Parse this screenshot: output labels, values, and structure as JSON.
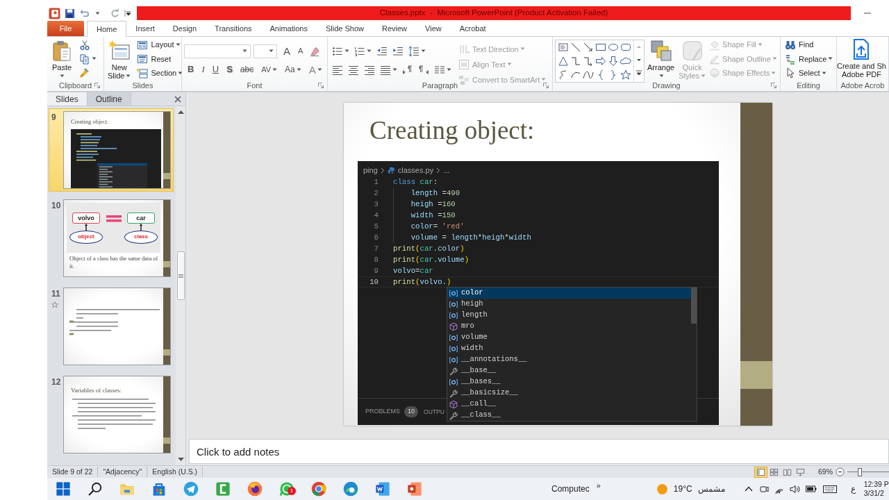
{
  "title_bar": {
    "title": "Classes.pptx  -  Microsoft PowerPoint (Product Activation Failed)"
  },
  "ribbon_tabs": [
    {
      "label": "File",
      "kind": "file",
      "selected": false
    },
    {
      "label": "Home",
      "kind": "tab",
      "selected": true
    },
    {
      "label": "Insert",
      "kind": "tab",
      "selected": false
    },
    {
      "label": "Design",
      "kind": "tab",
      "selected": false
    },
    {
      "label": "Transitions",
      "kind": "tab",
      "selected": false
    },
    {
      "label": "Animations",
      "kind": "tab",
      "selected": false
    },
    {
      "label": "Slide Show",
      "kind": "tab",
      "selected": false
    },
    {
      "label": "Review",
      "kind": "tab",
      "selected": false
    },
    {
      "label": "View",
      "kind": "tab",
      "selected": false
    },
    {
      "label": "Acrobat",
      "kind": "tab",
      "selected": false
    }
  ],
  "ribbon_groups": [
    {
      "label": "Clipboard",
      "launcher": true,
      "columns": [
        [
          {
            "kind": "large",
            "label": "Paste\n",
            "dropdown": true,
            "disabled": false
          }
        ],
        [
          {
            "kind": "icon",
            "dropdown": false,
            "disabled": false
          },
          {
            "kind": "icon",
            "dropdown": true,
            "disabled": false
          },
          {
            "kind": "icon",
            "dropdown": false,
            "disabled": false
          }
        ]
      ]
    },
    {
      "label": "Slides",
      "columns": [
        [
          {
            "kind": "large",
            "label": "New\nSlide",
            "dropdown": true,
            "disabled": false
          }
        ],
        [
          {
            "kind": "small",
            "label": "Layout",
            "dropdown": true,
            "disabled": false
          },
          {
            "kind": "small",
            "label": "Reset",
            "dropdown": false,
            "disabled": false
          },
          {
            "kind": "small",
            "label": "Section",
            "dropdown": true,
            "disabled": false
          }
        ]
      ]
    },
    {
      "label": "Font",
      "launcher": true,
      "columns": [
        [
          [
            {
              "kind": "combo"
            },
            {
              "kind": "combo"
            },
            {
              "kind": "glyph",
              "label": "A",
              "dropdown": false
            },
            {
              "kind": "glyph",
              "label": "A",
              "dropdown": false
            },
            {
              "kind": "icon",
              "dropdown": false,
              "disabled": false
            }
          ],
          [
            {
              "kind": "glyph",
              "label": "B",
              "dropdown": false
            },
            {
              "kind": "glyph",
              "label": "I",
              "dropdown": false
            },
            {
              "kind": "glyph",
              "label": "U",
              "dropdown": false
            },
            {
              "kind": "glyph",
              "label": "S",
              "dropdown": false
            },
            {
              "kind": "glyph",
              "label": "abc",
              "dropdown": false
            },
            {
              "kind": "glyph",
              "label": "AV",
              "dropdown": true
            },
            {
              "kind": "glyph",
              "label": "Aa",
              "dropdown": true
            },
            {
              "kind": "glyph",
              "label": "A",
              "dropdown": true
            }
          ]
        ]
      ]
    },
    {
      "label": "Paragraph",
      "launcher": true,
      "columns": [
        [
          [
            {
              "kind": "icon",
              "dropdown": true,
              "disabled": false
            },
            {
              "kind": "icon",
              "dropdown": true,
              "disabled": false
            },
            {
              "kind": "icon",
              "dropdown": false,
              "disabled": false
            },
            {
              "kind": "icon",
              "dropdown": false,
              "disabled": false
            },
            {
              "kind": "icon",
              "dropdown": true,
              "disabled": false
            }
          ],
          [
            {
              "kind": "icon",
              "dropdown": false,
              "disabled": false
            },
            {
              "kind": "icon",
              "dropdown": false,
              "disabled": false
            },
            {
              "kind": "icon",
              "dropdown": false,
              "disabled": false
            },
            {
              "kind": "icon",
              "dropdown": true,
              "disabled": false
            },
            {
              "kind": "icon",
              "dropdown": false,
              "disabled": false
            },
            {
              "kind": "icon",
              "dropdown": false,
              "disabled": false
            },
            {
              "kind": "icon",
              "dropdown": true,
              "disabled": false
            }
          ]
        ],
        [
          {
            "kind": "small",
            "label": "Text Direction",
            "dropdown": true,
            "disabled": true
          },
          {
            "kind": "small",
            "label": "Align Text",
            "dropdown": true,
            "disabled": true
          },
          {
            "kind": "small",
            "label": "Convert to SmartArt",
            "dropdown": true,
            "disabled": true
          }
        ]
      ]
    },
    {
      "label": "Drawing",
      "launcher": true,
      "columns": [
        [
          {
            "kind": "gallery"
          }
        ],
        [
          {
            "kind": "large",
            "label": "Arrange\n",
            "dropdown": true,
            "disabled": false
          }
        ],
        [
          {
            "kind": "large",
            "label": "Quick\nStyles",
            "dropdown": true,
            "disabled": true
          }
        ],
        [
          {
            "kind": "small",
            "label": "Shape Fill",
            "dropdown": true,
            "disabled": true
          },
          {
            "kind": "small",
            "label": "Shape Outline",
            "dropdown": true,
            "disabled": true
          },
          {
            "kind": "small",
            "label": "Shape Effects",
            "dropdown": true,
            "disabled": true
          }
        ]
      ]
    },
    {
      "label": "Editing",
      "columns": [
        [
          {
            "kind": "small",
            "label": "Find",
            "dropdown": false,
            "disabled": false
          },
          {
            "kind": "small",
            "label": "Replace",
            "dropdown": true,
            "disabled": false
          },
          {
            "kind": "small",
            "label": "Select",
            "dropdown": true,
            "disabled": false
          }
        ]
      ]
    },
    {
      "label": "Adobe Acrob",
      "columns": [
        [
          {
            "kind": "large",
            "label": "Create and Sh\nAdobe PDF",
            "dropdown": false,
            "disabled": false
          }
        ]
      ]
    }
  ],
  "slides_pane": {
    "tabs": [
      {
        "label": "Slides",
        "selected": true
      },
      {
        "label": "Outline",
        "selected": false
      }
    ],
    "thumbnails": [
      {
        "number": "9",
        "selected": true,
        "animated": false,
        "kind": "code",
        "title": "Creating object:"
      },
      {
        "number": "10",
        "selected": false,
        "animated": false,
        "kind": "diagram",
        "boxes": [
          "volvo",
          "car"
        ],
        "ovals": [
          "object",
          "class"
        ],
        "caption": "Object of a class has the same data of it."
      },
      {
        "number": "11",
        "selected": false,
        "animated": true,
        "kind": "bullets"
      },
      {
        "number": "12",
        "selected": false,
        "animated": false,
        "kind": "bullets",
        "title": "Variables of classes:"
      }
    ]
  },
  "slide": {
    "title": "Creating object:",
    "editor": {
      "breadcrumb": [
        "ping",
        "classes.py",
        "..."
      ],
      "lines": [
        {
          "number": "1",
          "active": false,
          "indent": false,
          "tokens": [
            {
              "text": "class ",
              "kind": "kw"
            },
            {
              "text": "car",
              "kind": "cls"
            },
            {
              "text": ":",
              "kind": "plain"
            }
          ]
        },
        {
          "number": "2",
          "active": false,
          "indent": true,
          "tokens": [
            {
              "text": "length",
              "kind": "var"
            },
            {
              "text": " =",
              "kind": "plain"
            },
            {
              "text": "490",
              "kind": "num"
            }
          ]
        },
        {
          "number": "3",
          "active": false,
          "indent": true,
          "tokens": [
            {
              "text": "heigh",
              "kind": "var"
            },
            {
              "text": " =",
              "kind": "plain"
            },
            {
              "text": "160",
              "kind": "num"
            }
          ]
        },
        {
          "number": "4",
          "active": false,
          "indent": true,
          "tokens": [
            {
              "text": "width",
              "kind": "var"
            },
            {
              "text": " =",
              "kind": "plain"
            },
            {
              "text": "150",
              "kind": "num"
            }
          ]
        },
        {
          "number": "5",
          "active": false,
          "indent": true,
          "tokens": [
            {
              "text": "color",
              "kind": "var"
            },
            {
              "text": "= ",
              "kind": "plain"
            },
            {
              "text": "'red'",
              "kind": "str"
            }
          ]
        },
        {
          "number": "6",
          "active": false,
          "indent": true,
          "tokens": [
            {
              "text": "volume",
              "kind": "var"
            },
            {
              "text": " = ",
              "kind": "plain"
            },
            {
              "text": "length",
              "kind": "var"
            },
            {
              "text": "*",
              "kind": "plain"
            },
            {
              "text": "heigh",
              "kind": "var"
            },
            {
              "text": "*",
              "kind": "plain"
            },
            {
              "text": "width",
              "kind": "var"
            }
          ]
        },
        {
          "number": "7",
          "active": false,
          "indent": false,
          "tokens": [
            {
              "text": "print",
              "kind": "fn"
            },
            {
              "text": "(",
              "kind": "br"
            },
            {
              "text": "car",
              "kind": "cls"
            },
            {
              "text": ".",
              "kind": "plain"
            },
            {
              "text": "color",
              "kind": "var"
            },
            {
              "text": ")",
              "kind": "br"
            }
          ]
        },
        {
          "number": "8",
          "active": false,
          "indent": false,
          "tokens": [
            {
              "text": "print",
              "kind": "fn"
            },
            {
              "text": "(",
              "kind": "br"
            },
            {
              "text": "car",
              "kind": "cls"
            },
            {
              "text": ".",
              "kind": "plain"
            },
            {
              "text": "volume",
              "kind": "var"
            },
            {
              "text": ")",
              "kind": "br"
            }
          ]
        },
        {
          "number": "9",
          "active": false,
          "indent": false,
          "tokens": [
            {
              "text": "volvo",
              "kind": "var"
            },
            {
              "text": "=",
              "kind": "plain"
            },
            {
              "text": "car",
              "kind": "cls"
            }
          ]
        },
        {
          "number": "10",
          "active": true,
          "indent": false,
          "tokens": [
            {
              "text": "print",
              "kind": "fn"
            },
            {
              "text": "(",
              "kind": "br"
            },
            {
              "text": "volvo",
              "kind": "var"
            },
            {
              "text": ".",
              "kind": "plain"
            },
            {
              "text": ")",
              "kind": "br"
            }
          ]
        }
      ],
      "suggestions": [
        {
          "label": "color",
          "kind": "field",
          "selected": true
        },
        {
          "label": "heigh",
          "kind": "field",
          "selected": false
        },
        {
          "label": "length",
          "kind": "field",
          "selected": false
        },
        {
          "label": "mro",
          "kind": "method",
          "selected": false
        },
        {
          "label": "volume",
          "kind": "field",
          "selected": false
        },
        {
          "label": "width",
          "kind": "field",
          "selected": false
        },
        {
          "label": "__annotations__",
          "kind": "field",
          "selected": false
        },
        {
          "label": "__base__",
          "kind": "property",
          "selected": false
        },
        {
          "label": "__bases__",
          "kind": "field",
          "selected": false
        },
        {
          "label": "__basicsize__",
          "kind": "property",
          "selected": false
        },
        {
          "label": "__call__",
          "kind": "method",
          "selected": false
        },
        {
          "label": "__class__",
          "kind": "property",
          "selected": false
        }
      ],
      "panel": {
        "problems": "PROBLEMS",
        "count": "10",
        "output": "OUTPU"
      }
    }
  },
  "notes": {
    "placeholder": "Click to add notes"
  },
  "status_bar": {
    "items": [
      "Slide 9 of 22",
      "\"Adjacency\"",
      "English (U.S.)"
    ],
    "views": [
      {
        "selected": true
      },
      {
        "selected": false
      },
      {
        "selected": false
      },
      {
        "selected": false
      }
    ],
    "zoom": "69%",
    "zoom_slider": {
      "level": 0.3
    }
  },
  "taskbar": {
    "badge": "1",
    "label": "Computec",
    "overflow": "»",
    "temperature": "19°C",
    "weather": "مشمس",
    "input_language": "ع",
    "time": "12:39 P",
    "date": "3/31/2"
  }
}
